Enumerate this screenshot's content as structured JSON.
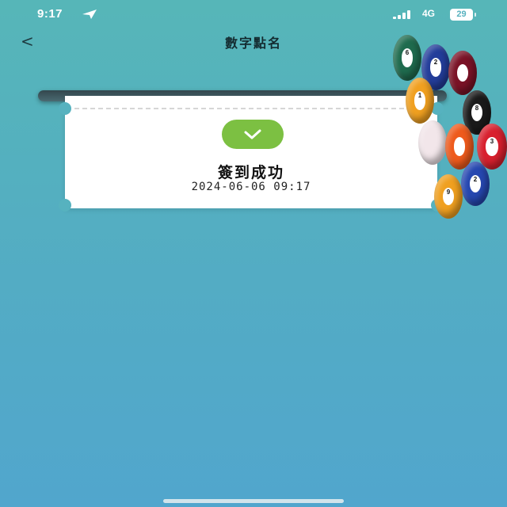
{
  "status_bar": {
    "time": "9:17",
    "network": "4G",
    "battery": "29"
  },
  "nav": {
    "back": "<",
    "title": "數字點名"
  },
  "card": {
    "message": "簽到成功",
    "timestamp": "2024-06-06 09:17"
  },
  "colors": {
    "background": "#56b2bf",
    "success_green": "#7cc042"
  },
  "icons": [
    "location-arrow-icon",
    "signal-icon",
    "battery-icon",
    "check-icon"
  ]
}
